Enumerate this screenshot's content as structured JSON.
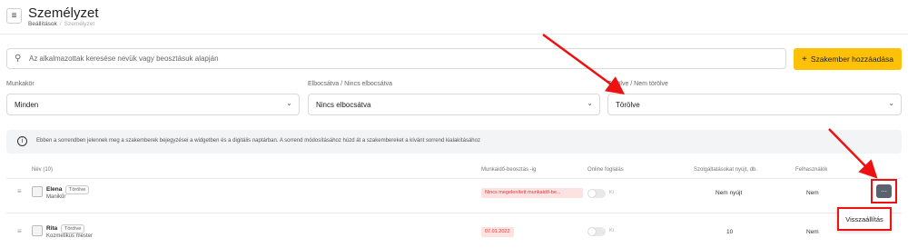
{
  "header": {
    "title": "Személyzet",
    "breadcrumb": [
      "Beállítások",
      "Személyzet"
    ],
    "menu_icon": "hamburger-icon"
  },
  "search": {
    "placeholder": "Az alkalmazottak keresése nevük vagy beosztásuk alapján",
    "icon": "search-icon"
  },
  "add_button": {
    "label": "Szakember hozzáadása",
    "icon": "plus-icon",
    "color": "#ffc107"
  },
  "filters": [
    {
      "label": "Munkakör",
      "value": "Minden"
    },
    {
      "label": "Elbocsátva / Nincs elbocsátva",
      "value": "Nincs elbocsátva"
    },
    {
      "label": "Törölve / Nem törölve",
      "value": "Törölve"
    }
  ],
  "info_text": "Ebben a sorrendben jelennek meg a szakemberek bejegyzései a widgetben és a digitális naptárban. A sorrend módosításához húzd át a szakembereket a kívánt sorrend kialakításához",
  "table": {
    "headers": [
      "Név (10)",
      "Munkaidő-beosztás -ig",
      "Online foglalás",
      "Szolgáltatásokat nyújt, db.",
      "Felhasználók"
    ],
    "rows": [
      {
        "name": "Elena",
        "badge": "Törölve",
        "role": "Manikűr",
        "schedule": "Nincs megelenített munkaidő-be...",
        "online_label": "Ki",
        "services": "Nem nyújt",
        "users": "Nem"
      },
      {
        "name": "Rita",
        "badge": "Törölve",
        "role": "Kozmetikus mester",
        "schedule": "07.01.2022",
        "online_label": "Ki",
        "services": "10",
        "users": "Nem"
      }
    ]
  },
  "row_menu": {
    "button_label": "...",
    "item": "Visszaállítás"
  },
  "colors": {
    "accent": "#ffc107",
    "highlight": "#e11111",
    "error_tag_bg": "#fde2e2",
    "error_tag_text": "#d33333"
  }
}
